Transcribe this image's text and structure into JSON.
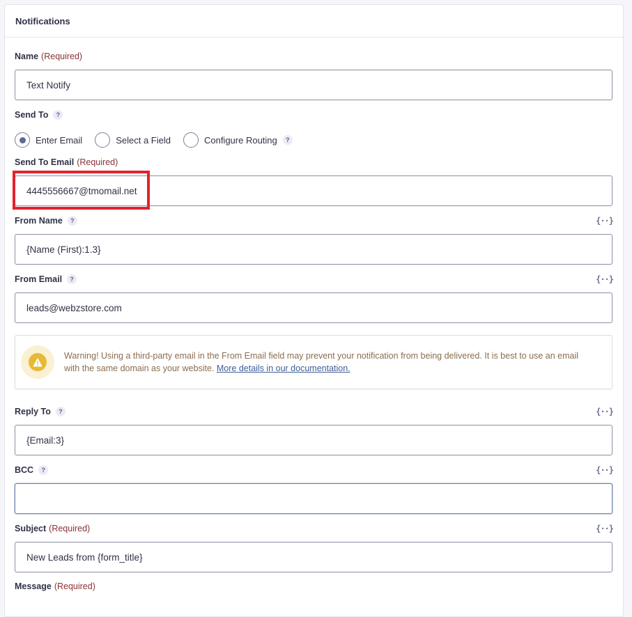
{
  "panel": {
    "title": "Notifications"
  },
  "required_label": "(Required)",
  "help_glyph": "?",
  "merge_tag_glyph": "{··}",
  "fields": {
    "name": {
      "label": "Name",
      "value": "Text Notify"
    },
    "send_to": {
      "label": "Send To",
      "options": [
        "Enter Email",
        "Select a Field",
        "Configure Routing"
      ],
      "selected": "Enter Email"
    },
    "send_to_email": {
      "label": "Send To Email",
      "value": "4445556667@tmomail.net"
    },
    "from_name": {
      "label": "From Name",
      "value": "{Name (First):1.3}"
    },
    "from_email": {
      "label": "From Email",
      "value": "leads@webzstore.com"
    },
    "reply_to": {
      "label": "Reply To",
      "value": "{Email:3}"
    },
    "bcc": {
      "label": "BCC",
      "value": ""
    },
    "subject": {
      "label": "Subject",
      "value": "New Leads from {form_title}"
    },
    "message": {
      "label": "Message"
    }
  },
  "warning": {
    "icon": "warning-triangle-icon",
    "text": "Warning! Using a third-party email in the From Email field may prevent your notification from being delivered. It is best to use an email with the same domain as your website.",
    "link_text": "More details in our documentation."
  },
  "colors": {
    "required": "#8a3236",
    "highlight": "#e0232e",
    "warning_icon": "#e7b935",
    "link": "#3e5d97"
  }
}
